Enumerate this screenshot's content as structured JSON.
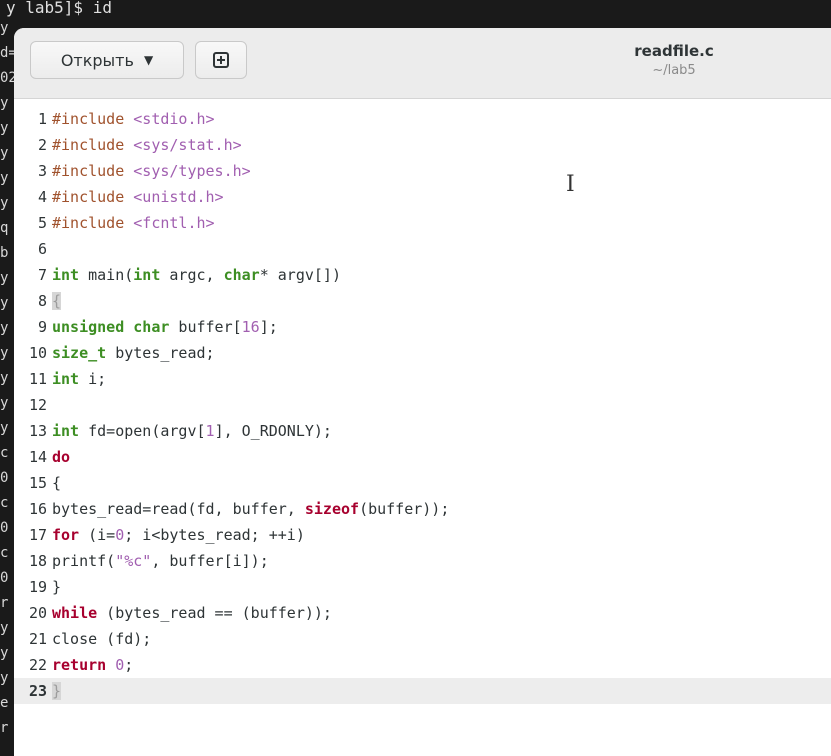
{
  "terminal": {
    "prompt_line": "y lab5]$ id",
    "left_glyphs": [
      "y",
      "d=",
      "02",
      "y",
      "y",
      "y",
      "y",
      "y",
      "q",
      "b",
      "y",
      "y",
      "y",
      "y",
      "y",
      "y",
      "y",
      "c",
      "0",
      "c",
      "0",
      "c",
      "0",
      "r",
      "y",
      "y",
      "y",
      "e",
      "r"
    ]
  },
  "header": {
    "open_label": "Открыть",
    "open_caret": "▼",
    "new_tab_icon": "document-new-icon",
    "title": "readfile.c",
    "subtitle": "~/lab5"
  },
  "editor": {
    "current_line": 23,
    "lines": [
      {
        "n": "1",
        "html": "<span class='pp'>#include</span> <span class='str'>&lt;stdio.h&gt;</span>",
        "text": "#include <stdio.h>"
      },
      {
        "n": "2",
        "text": "#include <sys/stat.h>"
      },
      {
        "n": "3",
        "text": "#include <sys/types.h>"
      },
      {
        "n": "4",
        "text": "#include <unistd.h>"
      },
      {
        "n": "5",
        "text": "#include <fcntl.h>"
      },
      {
        "n": "6",
        "text": ""
      },
      {
        "n": "7",
        "text": "int main(int argc, char* argv[])"
      },
      {
        "n": "8",
        "text": "{"
      },
      {
        "n": "9",
        "text": "unsigned char buffer[16];"
      },
      {
        "n": "10",
        "text": "size_t bytes_read;"
      },
      {
        "n": "11",
        "text": "int i;"
      },
      {
        "n": "12",
        "text": ""
      },
      {
        "n": "13",
        "text": "int fd=open(argv[1], O_RDONLY);"
      },
      {
        "n": "14",
        "text": "do"
      },
      {
        "n": "15",
        "text": "{"
      },
      {
        "n": "16",
        "text": "bytes_read=read(fd, buffer, sizeof(buffer));"
      },
      {
        "n": "17",
        "text": "for (i=0; i<bytes_read; ++i)"
      },
      {
        "n": "18",
        "text": "printf(\"%c\", buffer[i]);"
      },
      {
        "n": "19",
        "text": "}"
      },
      {
        "n": "20",
        "text": "while (bytes_read == (buffer));"
      },
      {
        "n": "21",
        "text": "close (fd);"
      },
      {
        "n": "22",
        "text": "return 0;"
      },
      {
        "n": "23",
        "text": "}"
      }
    ]
  },
  "colors": {
    "type_keyword": "#3d8e23",
    "control_keyword": "#a7002e",
    "preprocessor": "#a0522d",
    "string_literal": "#a15fb0"
  }
}
